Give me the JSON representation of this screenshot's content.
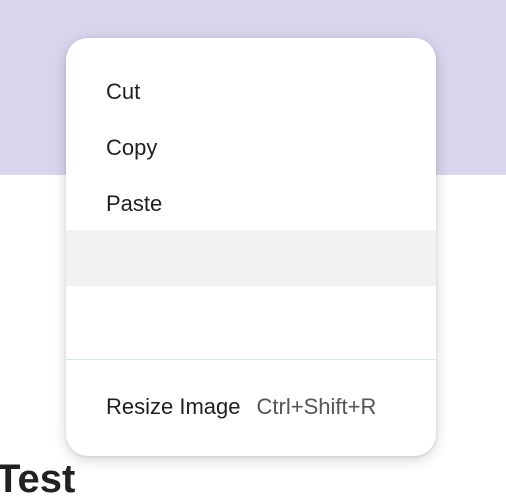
{
  "page": {
    "heading": "Test"
  },
  "context_menu": {
    "items": [
      {
        "label": "Cut"
      },
      {
        "label": "Copy"
      },
      {
        "label": "Paste"
      },
      {
        "label": ""
      },
      {
        "label": ""
      }
    ],
    "resize_image": {
      "label": "Resize Image",
      "shortcut": "Ctrl+Shift+R"
    }
  },
  "colors": {
    "band": "#d8d5ec",
    "hover": "#f1f1f1",
    "separator": "#d6e6ee"
  }
}
